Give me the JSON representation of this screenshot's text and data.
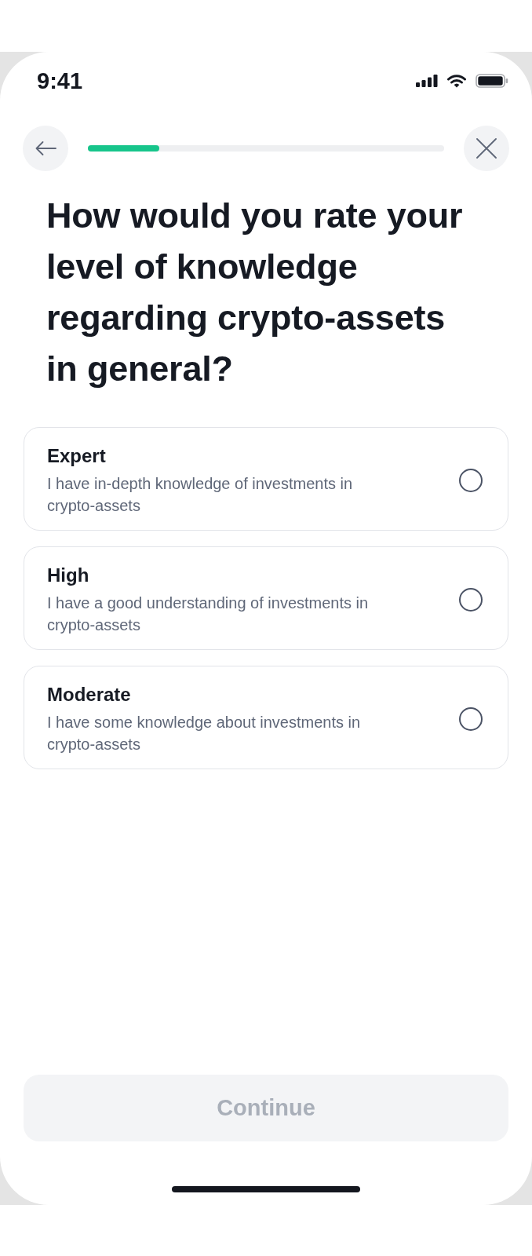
{
  "status_bar": {
    "time": "9:41"
  },
  "progress": {
    "level": 0.2
  },
  "question": "How would you rate your level of knowledge regarding crypto-assets in general?",
  "options": [
    {
      "title": "Expert",
      "description": "I have in-depth knowledge of investments in crypto-assets",
      "selected": false
    },
    {
      "title": "High",
      "description": "I have a good understanding of investments in crypto-assets",
      "selected": false
    },
    {
      "title": "Moderate",
      "description": "I have some knowledge about investments in crypto-assets",
      "selected": false
    }
  ],
  "continue_button": {
    "label": "Continue",
    "disabled": true
  }
}
